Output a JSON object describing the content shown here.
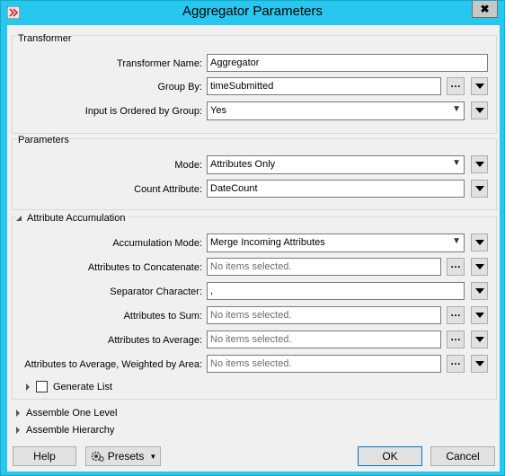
{
  "window": {
    "title": "Aggregator Parameters",
    "close_label": "✖"
  },
  "transformer": {
    "section_title": "Transformer",
    "name_label": "Transformer Name:",
    "name_value": "Aggregator",
    "group_by_label": "Group By:",
    "group_by_value": "timeSubmitted",
    "ordered_label": "Input is Ordered by Group:",
    "ordered_value": "Yes"
  },
  "parameters": {
    "section_title": "Parameters",
    "mode_label": "Mode:",
    "mode_value": "Attributes Only",
    "count_label": "Count Attribute:",
    "count_value": "DateCount"
  },
  "accumulation": {
    "section_title": "Attribute Accumulation",
    "mode_label": "Accumulation Mode:",
    "mode_value": "Merge Incoming Attributes",
    "concat_label": "Attributes to Concatenate:",
    "concat_placeholder": "No items selected.",
    "separator_label": "Separator Character:",
    "separator_value": ",",
    "sum_label": "Attributes to Sum:",
    "sum_placeholder": "No items selected.",
    "average_label": "Attributes to Average:",
    "average_placeholder": "No items selected.",
    "weighted_label": "Attributes to Average, Weighted by Area:",
    "weighted_placeholder": "No items selected.",
    "generate_list_label": "Generate List"
  },
  "collapsed": {
    "one_level_label": "Assemble One Level",
    "hierarchy_label": "Assemble Hierarchy"
  },
  "footer": {
    "help_label": "Help",
    "presets_label": "Presets",
    "ok_label": "OK",
    "cancel_label": "Cancel"
  },
  "icons": {
    "app": "fme-app-icon",
    "presets": "gear-icon"
  }
}
